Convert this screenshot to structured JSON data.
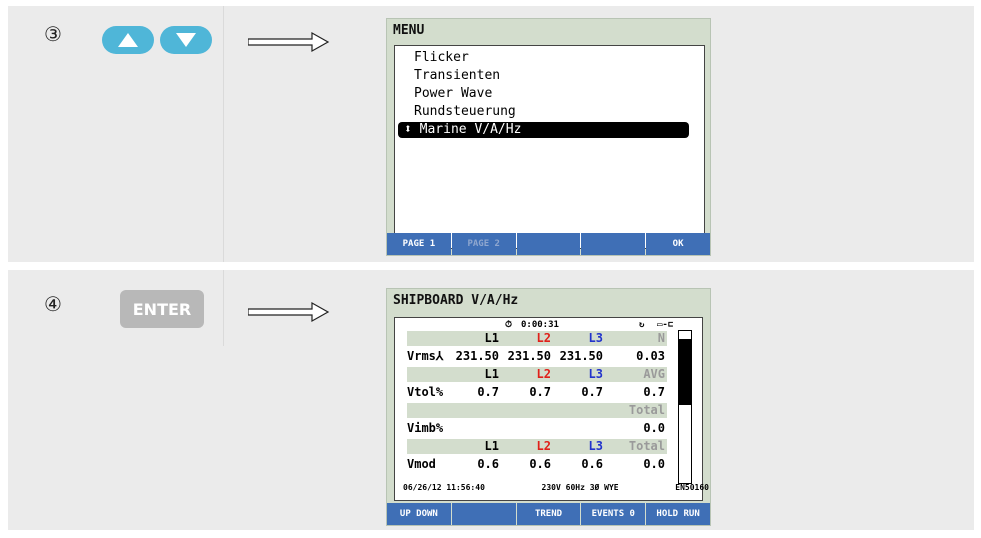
{
  "step3": {
    "number": "③",
    "menu": {
      "title": "MENU",
      "items": [
        "Flicker",
        "Transienten",
        "Power Wave",
        "Rundsteuerung"
      ],
      "selected_item": "Marine V/A/Hz"
    },
    "fkeys": [
      "PAGE 1",
      "PAGE 2",
      "",
      "",
      "OK"
    ]
  },
  "step4": {
    "number": "④",
    "enter_label": "ENTER",
    "screen": {
      "title": "SHIPBOARD V/A/Hz",
      "timer": "0:00:31",
      "rows": [
        {
          "label": "",
          "c1": "L1",
          "c2": "L2",
          "c3": "L3",
          "c4": "N",
          "band": true
        },
        {
          "label": "Vrms⅄",
          "c1": "231.50",
          "c2": "231.50",
          "c3": "231.50",
          "c4": "0.03",
          "band": false
        },
        {
          "label": "",
          "c1": "L1",
          "c2": "L2",
          "c3": "L3",
          "c4": "AVG",
          "band": true
        },
        {
          "label": "Vtol%",
          "c1": "0.7",
          "c2": "0.7",
          "c3": "0.7",
          "c4": "0.7",
          "band": false
        },
        {
          "label": "",
          "c1": "",
          "c2": "",
          "c3": "",
          "c4": "Total",
          "band": true
        },
        {
          "label": "Vimb%",
          "c1": "",
          "c2": "",
          "c3": "",
          "c4": "0.0",
          "band": false
        },
        {
          "label": "",
          "c1": "L1",
          "c2": "L2",
          "c3": "L3",
          "c4": "Total",
          "band": true
        },
        {
          "label": "Vmod",
          "c1": "0.6",
          "c2": "0.6",
          "c3": "0.6",
          "c4": "0.0",
          "band": false
        }
      ],
      "status": {
        "datetime": "06/26/12 11:56:40",
        "config": "230V 60Hz 3Ø WYE",
        "standard": "EN50160"
      }
    },
    "fkeys": [
      "UP DOWN",
      "",
      "TREND",
      "EVENTS 0",
      "HOLD RUN"
    ]
  },
  "colors": {
    "nav_blue": "#4fb6d8",
    "fkey_blue": "#3f6fb6",
    "screen_green": "#d3ddcd",
    "l1": "#000000",
    "l2": "#e0201a",
    "l3": "#2233cc",
    "dim": "#9a9a9a"
  }
}
